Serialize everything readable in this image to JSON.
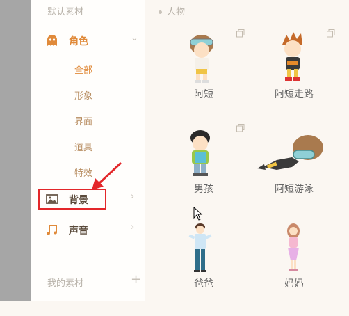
{
  "sidebar": {
    "default_section": "默认素材",
    "categories": {
      "role": {
        "label": "角色",
        "icon": "ghost-icon"
      },
      "background": {
        "label": "背景",
        "icon": "image-icon"
      },
      "sound": {
        "label": "声音",
        "icon": "music-note-icon"
      }
    },
    "subitems": [
      "全部",
      "形象",
      "界面",
      "道具",
      "特效"
    ],
    "my_section": "我的素材"
  },
  "main": {
    "header": "人物",
    "items": [
      {
        "name": "阿短"
      },
      {
        "name": "阿短走路"
      },
      {
        "name": "男孩"
      },
      {
        "name": "阿短游泳"
      },
      {
        "name": "爸爸"
      },
      {
        "name": "妈妈"
      }
    ]
  },
  "colors": {
    "accent": "#e08a3a",
    "highlight_box": "#e3272a",
    "sidebar_bg": "#fffefc",
    "main_bg": "#fbf7f2"
  }
}
